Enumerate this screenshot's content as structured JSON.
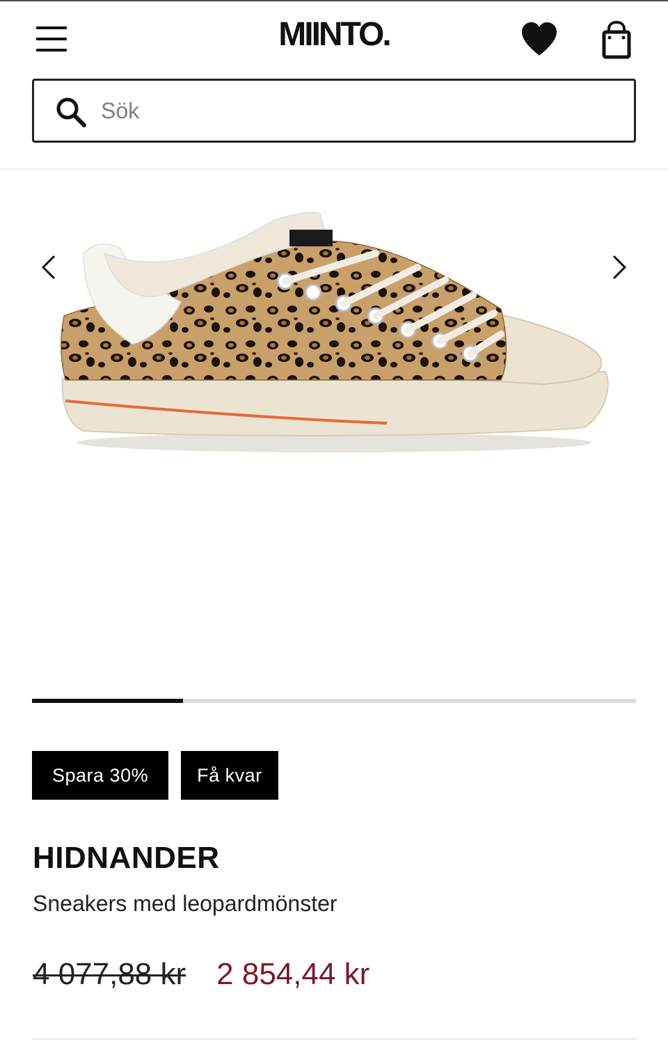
{
  "header": {
    "logo": "MIINTO.",
    "menu_icon": "hamburger-menu-icon",
    "wishlist_icon": "heart-icon",
    "bag_icon": "shopping-bag-icon"
  },
  "search": {
    "placeholder": "Sök",
    "value": "",
    "icon": "search-icon"
  },
  "carousel": {
    "image_alt": "sneaker-leopard-image",
    "prev_icon": "chevron-left-icon",
    "next_icon": "chevron-right-icon",
    "progress_fraction": 0.25
  },
  "badges": {
    "discount": "Spara 30%",
    "stock": "Få kvar"
  },
  "product": {
    "brand": "HIDNANDER",
    "name": "Sneakers med leopardmönster",
    "old_price": "4 077,88 kr",
    "new_price": "2 854,44 kr"
  },
  "colors": {
    "text": "#111111",
    "sale_price": "#7a1a2a",
    "badge_bg": "#000000"
  }
}
